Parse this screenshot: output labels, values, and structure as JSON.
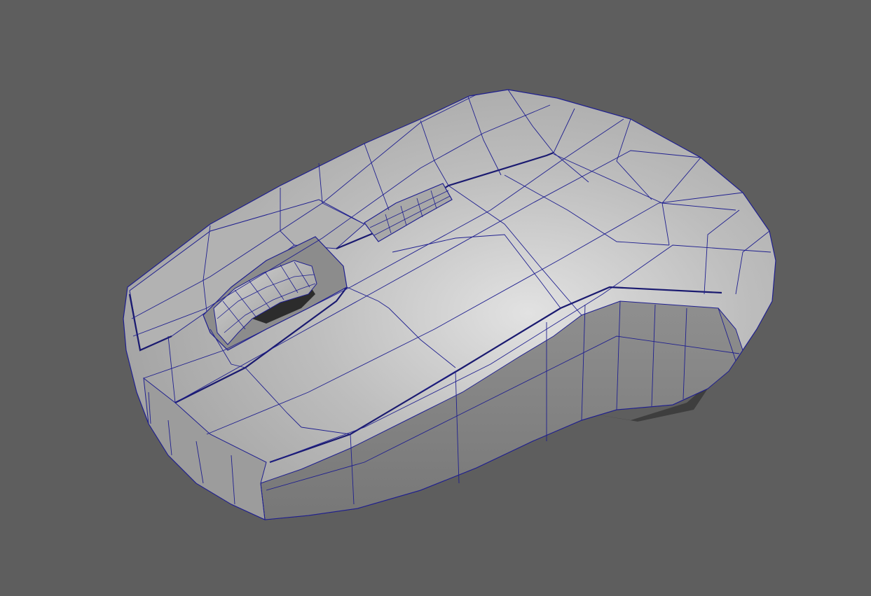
{
  "viewport": {
    "background_color": "#5e5e5e",
    "display_mode": "wireframe-on-shaded"
  },
  "model": {
    "object": "computer mouse",
    "surface_color": "#b9b9b9",
    "wireframe_color": "#1f1f8f",
    "icon": "mouse-mesh-icon"
  }
}
